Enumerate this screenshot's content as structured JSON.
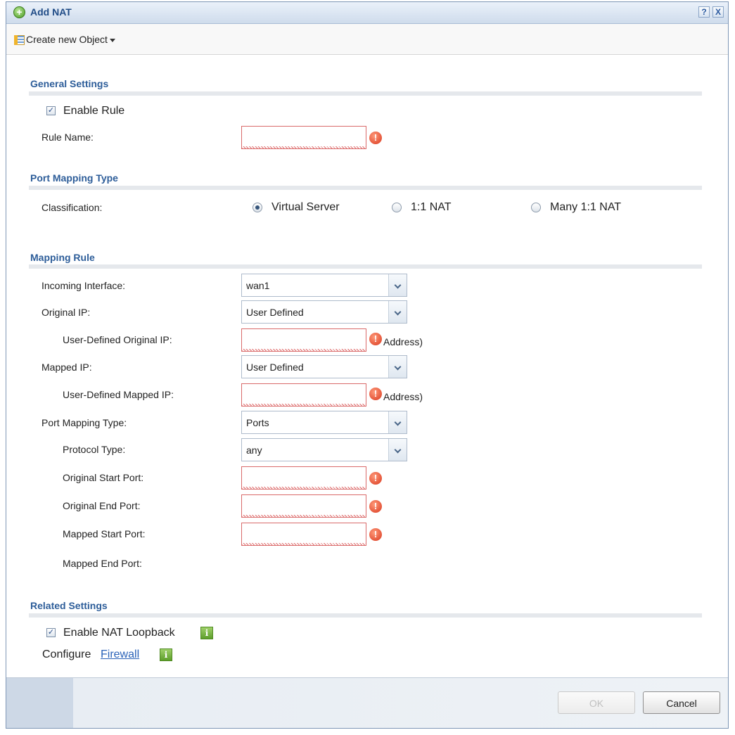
{
  "window": {
    "title": "Add NAT",
    "help_label": "?",
    "close_label": "X"
  },
  "toolbar": {
    "create_new_object_label": "Create new Object"
  },
  "general": {
    "title": "General Settings",
    "enable_rule_label": "Enable Rule",
    "enable_rule_checked": true,
    "rule_name_label": "Rule Name:",
    "rule_name_value": ""
  },
  "port_mapping_type": {
    "title": "Port Mapping Type",
    "classification_label": "Classification:",
    "options": [
      "Virtual Server",
      "1:1 NAT",
      "Many 1:1 NAT"
    ],
    "selected": "Virtual Server"
  },
  "mapping_rule": {
    "title": "Mapping Rule",
    "incoming_interface_label": "Incoming Interface:",
    "incoming_interface_value": "wan1",
    "original_ip_label": "Original IP:",
    "original_ip_value": "User Defined",
    "user_defined_original_ip_label": "User-Defined Original IP:",
    "user_defined_original_ip_value": "",
    "original_ip_hint": "Address)",
    "mapped_ip_label": "Mapped IP:",
    "mapped_ip_value": "User Defined",
    "user_defined_mapped_ip_label": "User-Defined Mapped IP:",
    "user_defined_mapped_ip_value": "",
    "mapped_ip_hint": "Address)",
    "port_mapping_type_label": "Port Mapping Type:",
    "port_mapping_type_value": "Ports",
    "protocol_type_label": "Protocol Type:",
    "protocol_type_value": "any",
    "original_start_port_label": "Original Start Port:",
    "original_end_port_label": "Original End Port:",
    "mapped_start_port_label": "Mapped Start Port:",
    "mapped_end_port_label": "Mapped End Port:"
  },
  "related": {
    "title": "Related Settings",
    "enable_nat_loopback_label": "Enable NAT Loopback",
    "enable_nat_loopback_checked": true,
    "configure_label": "Configure",
    "firewall_link": "Firewall"
  },
  "buttons": {
    "ok_label": "OK",
    "cancel_label": "Cancel"
  },
  "icons": {
    "error_glyph": "!",
    "info_glyph": "i",
    "check_glyph": "✓",
    "add_glyph": "+"
  },
  "colors": {
    "title_text": "#1f4b86",
    "section_title": "#2d5d99",
    "error_border": "#d96a6a",
    "link": "#2a62b8"
  }
}
